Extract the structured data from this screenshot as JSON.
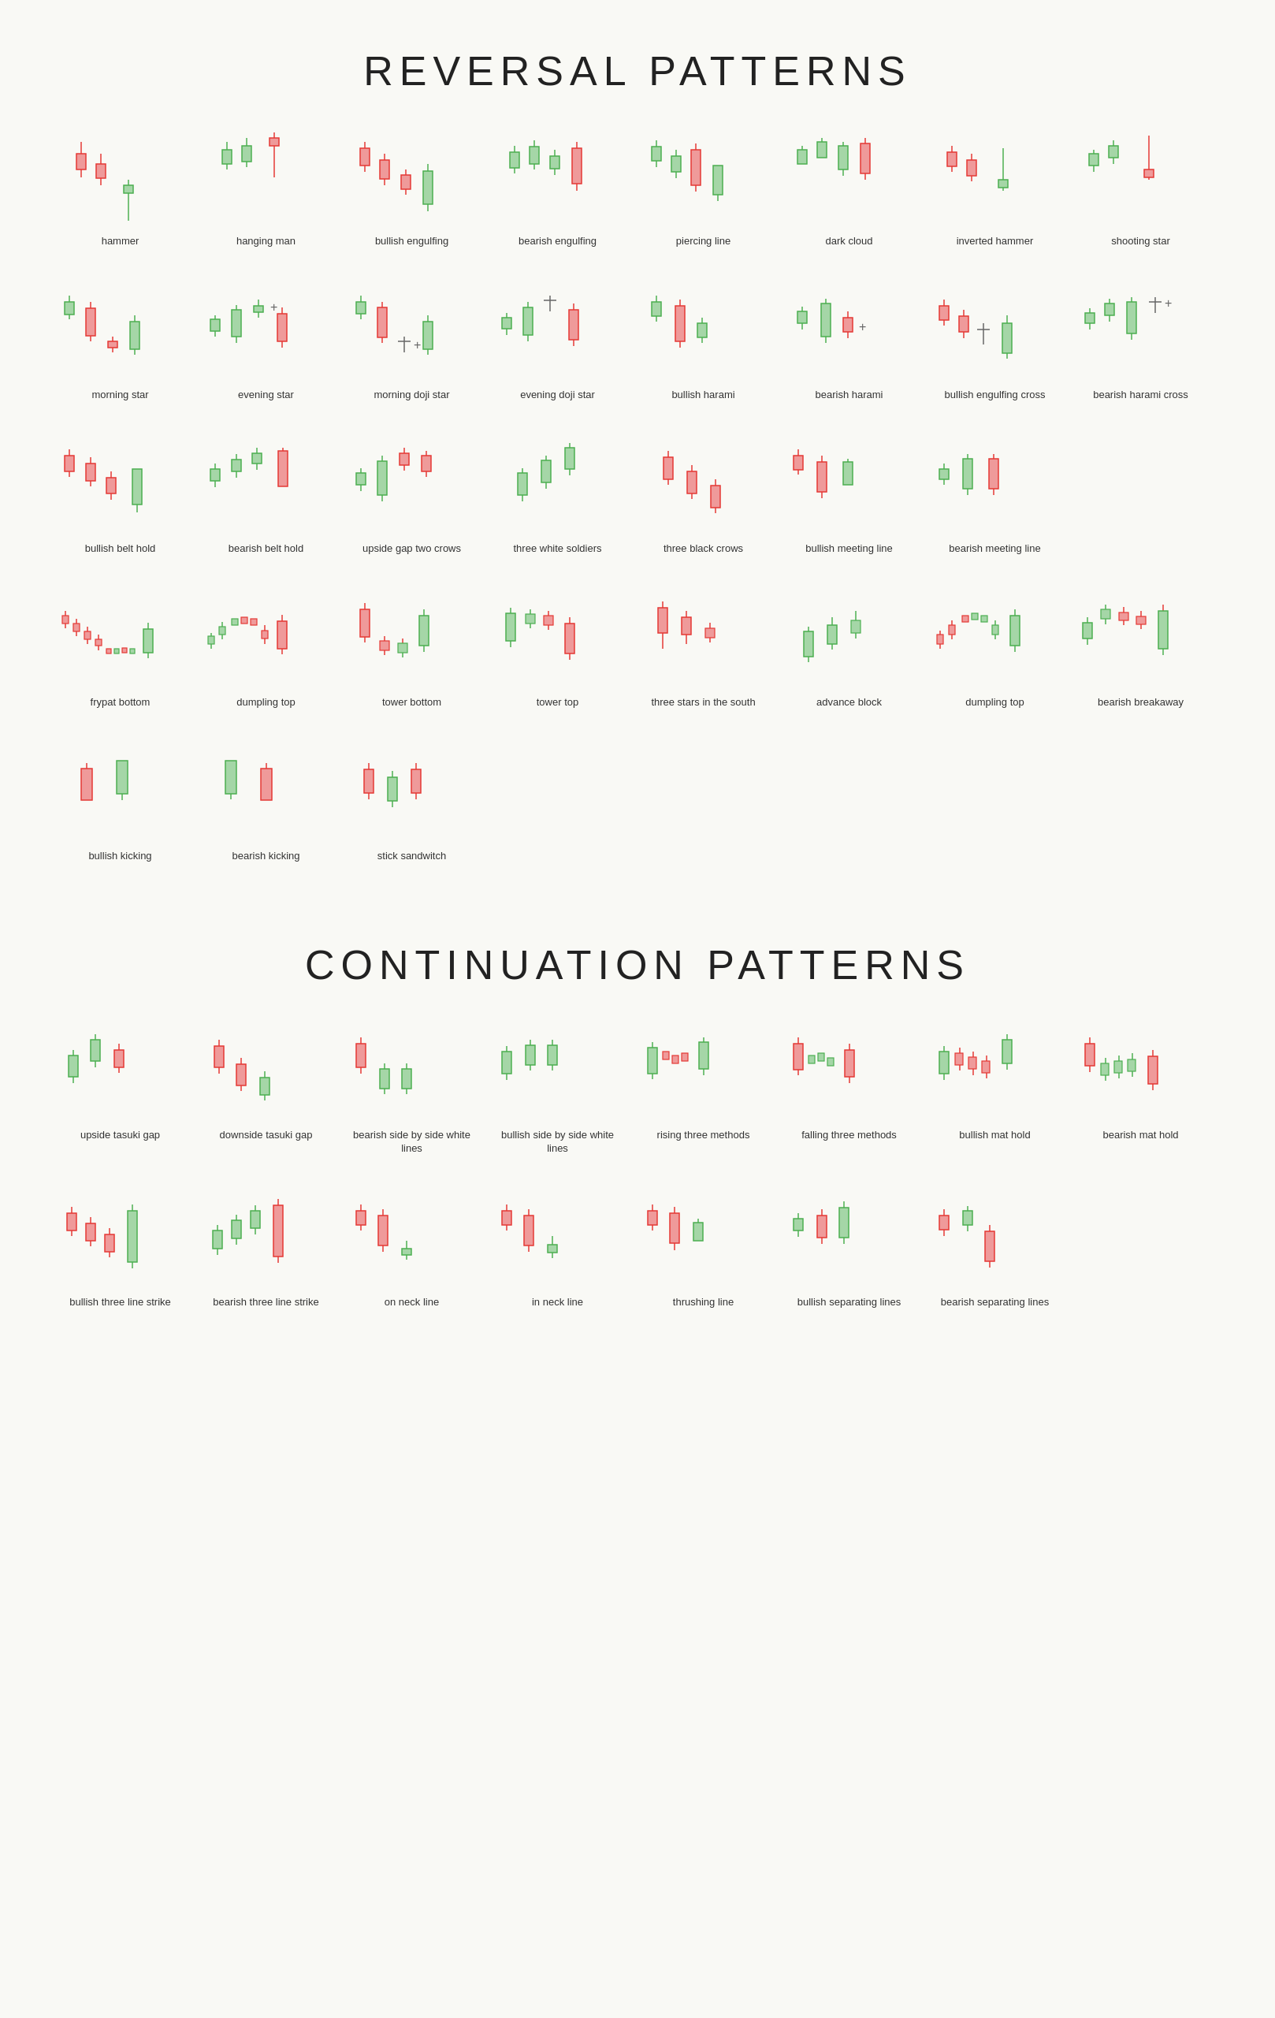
{
  "reversal": {
    "title": "REVERSAL PATTERNS",
    "patterns": [
      {
        "id": "hammer",
        "label": "hammer"
      },
      {
        "id": "hanging-man",
        "label": "hanging man"
      },
      {
        "id": "bullish-engulfing",
        "label": "bullish engulfing"
      },
      {
        "id": "bearish-engulfing",
        "label": "bearish engulfing"
      },
      {
        "id": "piercing-line",
        "label": "piercing line"
      },
      {
        "id": "dark-cloud",
        "label": "dark cloud"
      },
      {
        "id": "inverted-hammer",
        "label": "inverted hammer"
      },
      {
        "id": "shooting-star",
        "label": "shooting star"
      },
      {
        "id": "morning-star",
        "label": "morning star"
      },
      {
        "id": "evening-star",
        "label": "evening star"
      },
      {
        "id": "morning-doji-star",
        "label": "morning doji star"
      },
      {
        "id": "evening-doji-star",
        "label": "evening doji star"
      },
      {
        "id": "bullish-harami",
        "label": "bullish harami"
      },
      {
        "id": "bearish-harami",
        "label": "bearish harami"
      },
      {
        "id": "bullish-engulfing-cross",
        "label": "bullish engulfing cross"
      },
      {
        "id": "bearish-harami-cross",
        "label": "bearish harami cross"
      },
      {
        "id": "bullish-belt-hold",
        "label": "bullish belt hold"
      },
      {
        "id": "bearish-belt-hold",
        "label": "bearish belt hold"
      },
      {
        "id": "upside-gap-two-crows",
        "label": "upside gap two crows"
      },
      {
        "id": "three-white-soldiers",
        "label": "three white soldiers"
      },
      {
        "id": "three-black-crows",
        "label": "three black crows"
      },
      {
        "id": "bullish-meeting-line",
        "label": "bullish meeting line"
      },
      {
        "id": "bearish-meeting-line",
        "label": "bearish meeting line"
      },
      {
        "id": "frypat-bottom",
        "label": "frypat bottom"
      },
      {
        "id": "dumpling-top",
        "label": "dumpling top"
      },
      {
        "id": "tower-bottom",
        "label": "tower bottom"
      },
      {
        "id": "tower-top",
        "label": "tower top"
      },
      {
        "id": "three-stars-south",
        "label": "three stars in the south"
      },
      {
        "id": "advance-block",
        "label": "advance block"
      },
      {
        "id": "dumpling-top2",
        "label": "dumpling top"
      },
      {
        "id": "bearish-breakaway",
        "label": "bearish breakaway"
      },
      {
        "id": "bullish-kicking",
        "label": "bullish kicking"
      },
      {
        "id": "bearish-kicking",
        "label": "bearish kicking"
      },
      {
        "id": "stick-sandwitch",
        "label": "stick sandwitch"
      }
    ]
  },
  "continuation": {
    "title": "CONTINUATION PATTERNS",
    "patterns": [
      {
        "id": "upside-tasuki-gap",
        "label": "upside tasuki gap"
      },
      {
        "id": "downside-tasuki-gap",
        "label": "downside tasuki gap"
      },
      {
        "id": "bearish-side-by-side",
        "label": "bearish side by side white lines"
      },
      {
        "id": "bullish-side-by-side",
        "label": "bullish side by side white lines"
      },
      {
        "id": "rising-three-methods",
        "label": "rising three methods"
      },
      {
        "id": "falling-three-methods",
        "label": "falling three methods"
      },
      {
        "id": "bullish-mat-hold",
        "label": "bullish mat hold"
      },
      {
        "id": "bearish-mat-hold",
        "label": "bearish mat hold"
      },
      {
        "id": "bullish-three-line-strike",
        "label": "bullish three line strike"
      },
      {
        "id": "bearish-three-line-strike",
        "label": "bearish three line strike"
      },
      {
        "id": "on-neck-line",
        "label": "on neck line"
      },
      {
        "id": "in-neck-line",
        "label": "in neck line"
      },
      {
        "id": "thrushing-line",
        "label": "thrushing line"
      },
      {
        "id": "bullish-separating-lines",
        "label": "bullish separating lines"
      },
      {
        "id": "bearish-separating-lines",
        "label": "bearish separating lines"
      }
    ]
  }
}
